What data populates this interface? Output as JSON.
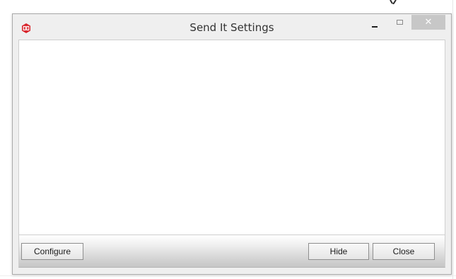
{
  "window": {
    "title": "Send It Settings",
    "app_icon": "send-it-app-icon",
    "controls": {
      "minimize_icon": "minimize-icon",
      "maximize_icon": "maximize-icon",
      "close_icon": "close-icon",
      "close_glyph": "✕"
    }
  },
  "footer": {
    "configure_label": "Configure",
    "hide_label": "Hide",
    "close_label": "Close"
  },
  "colors": {
    "app_icon_red": "#d8232a",
    "close_button_bg": "#c7c7c7",
    "window_bg": "#efefef"
  }
}
